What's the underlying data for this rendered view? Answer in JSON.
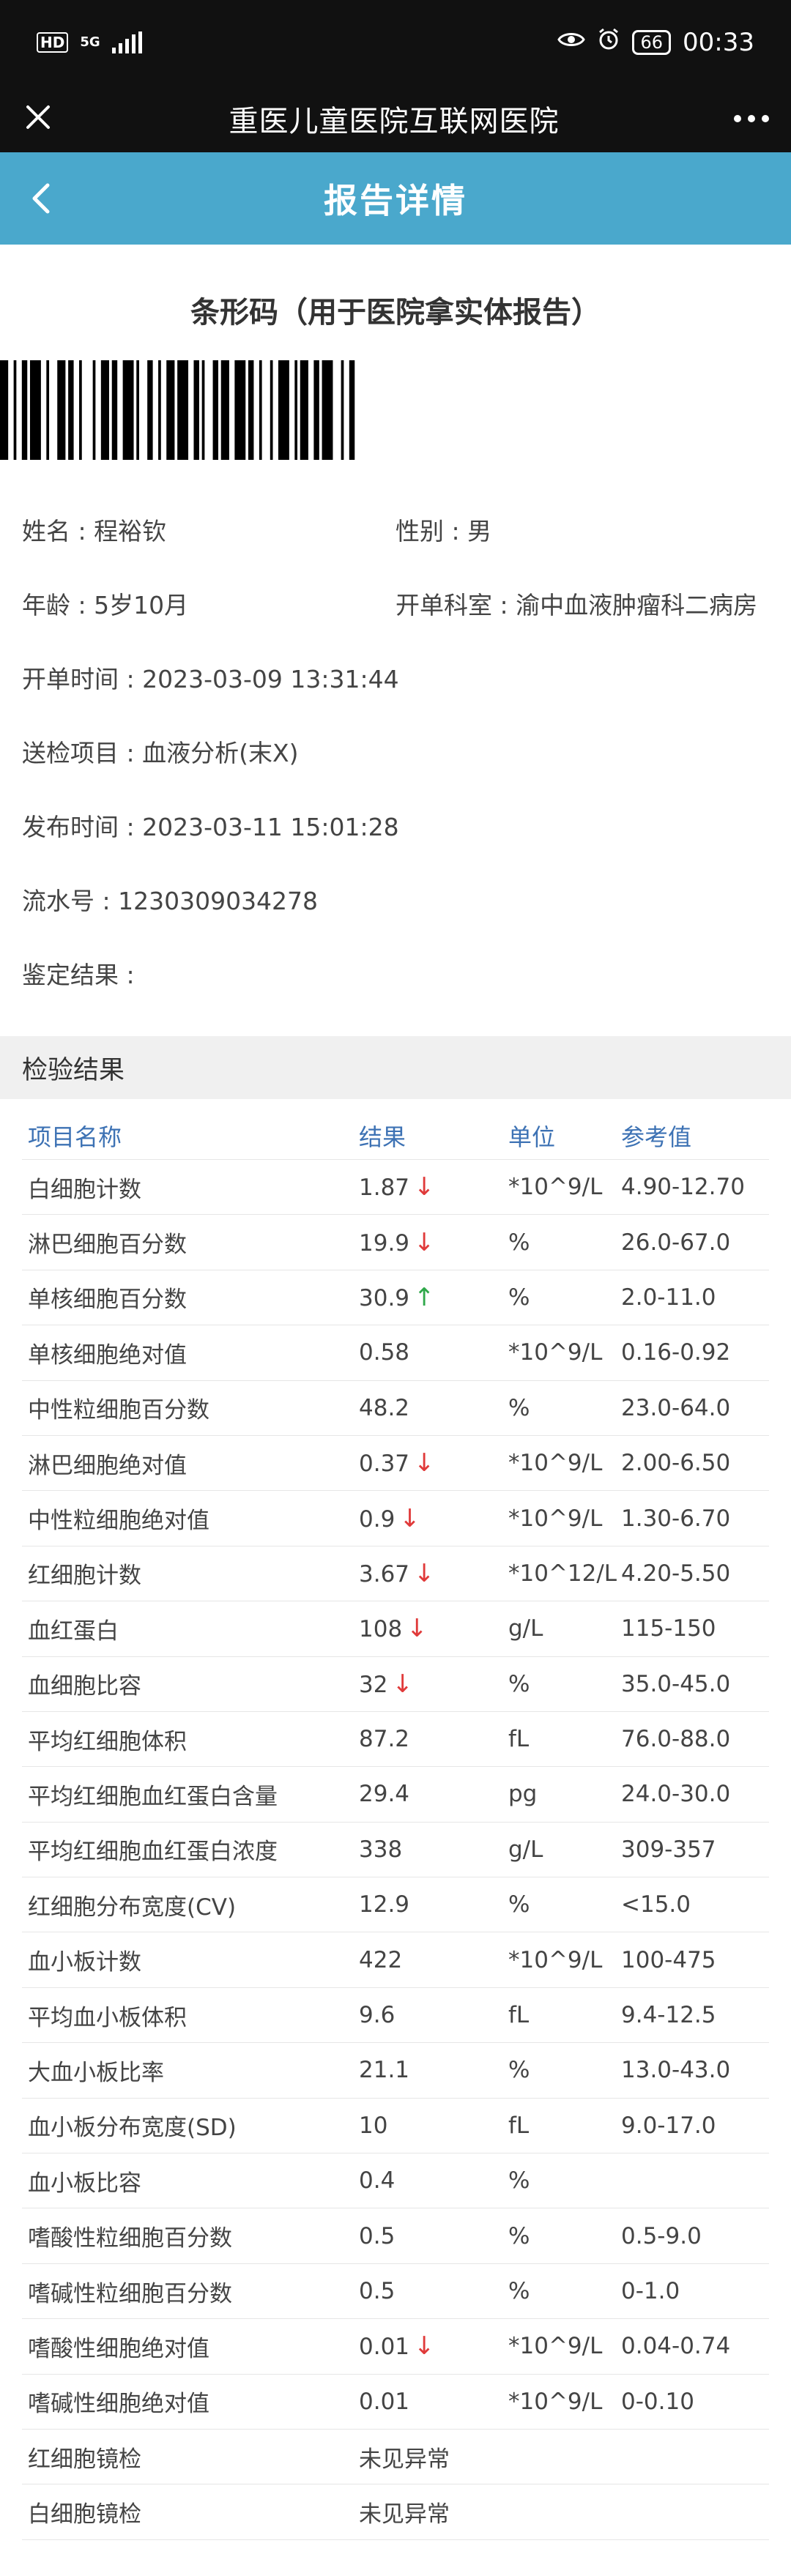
{
  "status_bar": {
    "hd": "HD",
    "network": "5G",
    "battery": "66",
    "time": "00:33",
    "icons": [
      "eye-icon",
      "alarm-icon"
    ]
  },
  "app_bar": {
    "title": "重医儿童医院互联网医院"
  },
  "header": {
    "title": "报告详情"
  },
  "barcode": {
    "title": "条形码（用于医院拿实体报告）"
  },
  "patient": {
    "name": "姓名 : 程裕钦",
    "gender": "性别 : 男",
    "age": "年龄 : 5岁10月",
    "department": "开单科室 : 渝中血液肿瘤科二病房",
    "order_time": "开单时间 : 2023-03-09 13:31:44",
    "test_item": "送检项目 : 血液分析(末X)",
    "publish_time": "发布时间 : 2023-03-11 15:01:28",
    "serial": "流水号 : 1230309034278",
    "diagnosis": "鉴定结果 :"
  },
  "results": {
    "section_title": "检验结果",
    "headers": [
      "项目名称",
      "结果",
      "单位",
      "参考值"
    ],
    "rows": [
      {
        "name": "白细胞计数",
        "value": "1.87",
        "flag": "down",
        "unit": "*10^9/L",
        "ref": "4.90-12.70"
      },
      {
        "name": "淋巴细胞百分数",
        "value": "19.9",
        "flag": "down",
        "unit": "%",
        "ref": "26.0-67.0"
      },
      {
        "name": "单核细胞百分数",
        "value": "30.9",
        "flag": "up",
        "unit": "%",
        "ref": "2.0-11.0"
      },
      {
        "name": "单核细胞绝对值",
        "value": "0.58",
        "flag": "",
        "unit": "*10^9/L",
        "ref": "0.16-0.92"
      },
      {
        "name": "中性粒细胞百分数",
        "value": "48.2",
        "flag": "",
        "unit": "%",
        "ref": "23.0-64.0"
      },
      {
        "name": "淋巴细胞绝对值",
        "value": "0.37",
        "flag": "down",
        "unit": "*10^9/L",
        "ref": "2.00-6.50"
      },
      {
        "name": "中性粒细胞绝对值",
        "value": "0.9",
        "flag": "down",
        "unit": "*10^9/L",
        "ref": "1.30-6.70"
      },
      {
        "name": "红细胞计数",
        "value": "3.67",
        "flag": "down",
        "unit": "*10^12/L",
        "ref": "4.20-5.50"
      },
      {
        "name": "血红蛋白",
        "value": "108",
        "flag": "down",
        "unit": "g/L",
        "ref": "115-150"
      },
      {
        "name": "血细胞比容",
        "value": "32",
        "flag": "down",
        "unit": "%",
        "ref": "35.0-45.0"
      },
      {
        "name": "平均红细胞体积",
        "value": "87.2",
        "flag": "",
        "unit": "fL",
        "ref": "76.0-88.0"
      },
      {
        "name": "平均红细胞血红蛋白含量",
        "value": "29.4",
        "flag": "",
        "unit": "pg",
        "ref": "24.0-30.0"
      },
      {
        "name": "平均红细胞血红蛋白浓度",
        "value": "338",
        "flag": "",
        "unit": "g/L",
        "ref": "309-357"
      },
      {
        "name": "红细胞分布宽度(CV)",
        "value": "12.9",
        "flag": "",
        "unit": "%",
        "ref": "<15.0"
      },
      {
        "name": "血小板计数",
        "value": "422",
        "flag": "",
        "unit": "*10^9/L",
        "ref": "100-475"
      },
      {
        "name": "平均血小板体积",
        "value": "9.6",
        "flag": "",
        "unit": "fL",
        "ref": "9.4-12.5"
      },
      {
        "name": "大血小板比率",
        "value": "21.1",
        "flag": "",
        "unit": "%",
        "ref": "13.0-43.0"
      },
      {
        "name": "血小板分布宽度(SD)",
        "value": "10",
        "flag": "",
        "unit": "fL",
        "ref": "9.0-17.0"
      },
      {
        "name": "血小板比容",
        "value": "0.4",
        "flag": "",
        "unit": "%",
        "ref": ""
      },
      {
        "name": "嗜酸性粒细胞百分数",
        "value": "0.5",
        "flag": "",
        "unit": "%",
        "ref": "0.5-9.0"
      },
      {
        "name": "嗜碱性粒细胞百分数",
        "value": "0.5",
        "flag": "",
        "unit": "%",
        "ref": "0-1.0"
      },
      {
        "name": "嗜酸性细胞绝对值",
        "value": "0.01",
        "flag": "down",
        "unit": "*10^9/L",
        "ref": "0.04-0.74"
      },
      {
        "name": "嗜碱性细胞绝对值",
        "value": "0.01",
        "flag": "",
        "unit": "*10^9/L",
        "ref": "0-0.10"
      },
      {
        "name": "红细胞镜检",
        "value": "未见异常",
        "flag": "",
        "unit": "",
        "ref": ""
      },
      {
        "name": "白细胞镜检",
        "value": "未见异常",
        "flag": "",
        "unit": "",
        "ref": ""
      }
    ]
  },
  "arrows": {
    "down": "↓",
    "up": "↑"
  }
}
